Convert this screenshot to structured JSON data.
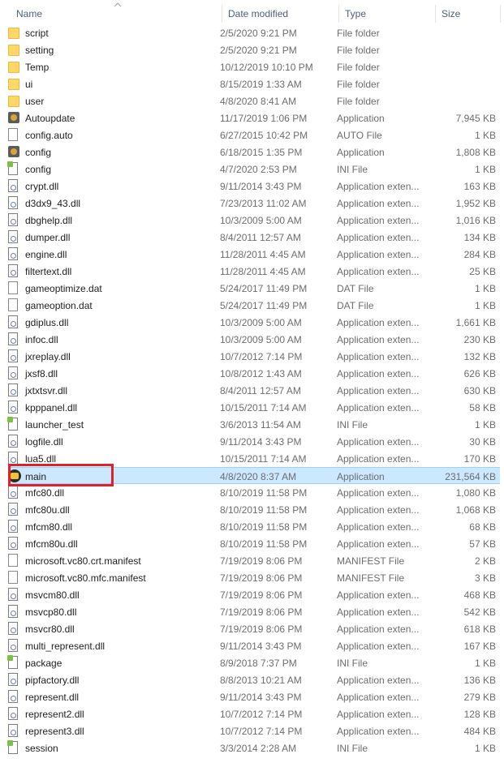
{
  "columns": {
    "name": "Name",
    "date": "Date modified",
    "type": "Type",
    "size": "Size"
  },
  "rows": [
    {
      "name": "script",
      "date": "2/5/2020 9:21 PM",
      "type": "File folder",
      "size": "",
      "icon": "folder-icon"
    },
    {
      "name": "setting",
      "date": "2/5/2020 9:21 PM",
      "type": "File folder",
      "size": "",
      "icon": "folder-icon"
    },
    {
      "name": "Temp",
      "date": "10/12/2019 10:10 PM",
      "type": "File folder",
      "size": "",
      "icon": "folder-icon"
    },
    {
      "name": "ui",
      "date": "8/15/2019 1:33 AM",
      "type": "File folder",
      "size": "",
      "icon": "folder-icon"
    },
    {
      "name": "user",
      "date": "4/8/2020 8:41 AM",
      "type": "File folder",
      "size": "",
      "icon": "folder-icon"
    },
    {
      "name": "Autoupdate",
      "date": "11/17/2019 1:06 PM",
      "type": "Application",
      "size": "7,945 KB",
      "icon": "app-icon"
    },
    {
      "name": "config.auto",
      "date": "6/27/2015 10:42 PM",
      "type": "AUTO File",
      "size": "1 KB",
      "icon": "file-icon"
    },
    {
      "name": "config",
      "date": "6/18/2015 1:35 PM",
      "type": "Application",
      "size": "1,808 KB",
      "icon": "app-icon"
    },
    {
      "name": "config",
      "date": "4/7/2020 2:53 PM",
      "type": "INI File",
      "size": "1 KB",
      "icon": "ini-icon"
    },
    {
      "name": "crypt.dll",
      "date": "9/11/2014 3:43 PM",
      "type": "Application exten...",
      "size": "163 KB",
      "icon": "dll-icon"
    },
    {
      "name": "d3dx9_43.dll",
      "date": "7/23/2013 11:02 AM",
      "type": "Application exten...",
      "size": "1,952 KB",
      "icon": "dll-icon"
    },
    {
      "name": "dbghelp.dll",
      "date": "10/3/2009 5:00 AM",
      "type": "Application exten...",
      "size": "1,016 KB",
      "icon": "dll-icon"
    },
    {
      "name": "dumper.dll",
      "date": "8/4/2011 12:57 AM",
      "type": "Application exten...",
      "size": "134 KB",
      "icon": "dll-icon"
    },
    {
      "name": "engine.dll",
      "date": "11/28/2011 4:45 AM",
      "type": "Application exten...",
      "size": "284 KB",
      "icon": "dll-icon"
    },
    {
      "name": "filtertext.dll",
      "date": "11/28/2011 4:45 AM",
      "type": "Application exten...",
      "size": "25 KB",
      "icon": "dll-icon"
    },
    {
      "name": "gameoptimize.dat",
      "date": "5/24/2017 11:49 PM",
      "type": "DAT File",
      "size": "1 KB",
      "icon": "file-icon"
    },
    {
      "name": "gameoption.dat",
      "date": "5/24/2017 11:49 PM",
      "type": "DAT File",
      "size": "1 KB",
      "icon": "file-icon"
    },
    {
      "name": "gdiplus.dll",
      "date": "10/3/2009 5:00 AM",
      "type": "Application exten...",
      "size": "1,661 KB",
      "icon": "dll-icon"
    },
    {
      "name": "infoc.dll",
      "date": "10/3/2009 5:00 AM",
      "type": "Application exten...",
      "size": "230 KB",
      "icon": "dll-icon"
    },
    {
      "name": "jxreplay.dll",
      "date": "10/7/2012 7:14 PM",
      "type": "Application exten...",
      "size": "132 KB",
      "icon": "dll-icon"
    },
    {
      "name": "jxsf8.dll",
      "date": "10/8/2012 1:43 AM",
      "type": "Application exten...",
      "size": "626 KB",
      "icon": "dll-icon"
    },
    {
      "name": "jxtxtsvr.dll",
      "date": "8/4/2011 12:57 AM",
      "type": "Application exten...",
      "size": "630 KB",
      "icon": "dll-icon"
    },
    {
      "name": "kpppanel.dll",
      "date": "10/15/2011 7:14 AM",
      "type": "Application exten...",
      "size": "58 KB",
      "icon": "dll-icon"
    },
    {
      "name": "launcher_test",
      "date": "3/6/2013 11:54 AM",
      "type": "INI File",
      "size": "1 KB",
      "icon": "ini-icon"
    },
    {
      "name": "logfile.dll",
      "date": "9/11/2014 3:43 PM",
      "type": "Application exten...",
      "size": "30 KB",
      "icon": "dll-icon"
    },
    {
      "name": "lua5.dll",
      "date": "10/15/2011 7:14 AM",
      "type": "Application exten...",
      "size": "170 KB",
      "icon": "dll-icon"
    },
    {
      "name": "main",
      "date": "4/8/2020 8:37 AM",
      "type": "Application",
      "size": "231,564 KB",
      "icon": "main-app-icon",
      "selected": true
    },
    {
      "name": "mfc80.dll",
      "date": "8/10/2019 11:58 PM",
      "type": "Application exten...",
      "size": "1,080 KB",
      "icon": "dll-icon"
    },
    {
      "name": "mfc80u.dll",
      "date": "8/10/2019 11:58 PM",
      "type": "Application exten...",
      "size": "1,068 KB",
      "icon": "dll-icon"
    },
    {
      "name": "mfcm80.dll",
      "date": "8/10/2019 11:58 PM",
      "type": "Application exten...",
      "size": "68 KB",
      "icon": "dll-icon"
    },
    {
      "name": "mfcm80u.dll",
      "date": "8/10/2019 11:58 PM",
      "type": "Application exten...",
      "size": "57 KB",
      "icon": "dll-icon"
    },
    {
      "name": "microsoft.vc80.crt.manifest",
      "date": "7/19/2019 8:06 PM",
      "type": "MANIFEST File",
      "size": "2 KB",
      "icon": "file-icon"
    },
    {
      "name": "microsoft.vc80.mfc.manifest",
      "date": "7/19/2019 8:06 PM",
      "type": "MANIFEST File",
      "size": "3 KB",
      "icon": "file-icon"
    },
    {
      "name": "msvcm80.dll",
      "date": "7/19/2019 8:06 PM",
      "type": "Application exten...",
      "size": "468 KB",
      "icon": "dll-icon"
    },
    {
      "name": "msvcp80.dll",
      "date": "7/19/2019 8:06 PM",
      "type": "Application exten...",
      "size": "542 KB",
      "icon": "dll-icon"
    },
    {
      "name": "msvcr80.dll",
      "date": "7/19/2019 8:06 PM",
      "type": "Application exten...",
      "size": "618 KB",
      "icon": "dll-icon"
    },
    {
      "name": "multi_represent.dll",
      "date": "9/11/2014 3:43 PM",
      "type": "Application exten...",
      "size": "167 KB",
      "icon": "dll-icon"
    },
    {
      "name": "package",
      "date": "8/9/2018 7:37 PM",
      "type": "INI File",
      "size": "1 KB",
      "icon": "ini-icon"
    },
    {
      "name": "pipfactory.dll",
      "date": "8/8/2013 10:21 AM",
      "type": "Application exten...",
      "size": "136 KB",
      "icon": "dll-icon"
    },
    {
      "name": "represent.dll",
      "date": "9/11/2014 3:43 PM",
      "type": "Application exten...",
      "size": "279 KB",
      "icon": "dll-icon"
    },
    {
      "name": "represent2.dll",
      "date": "10/7/2012 7:14 PM",
      "type": "Application exten...",
      "size": "128 KB",
      "icon": "dll-icon"
    },
    {
      "name": "represent3.dll",
      "date": "10/7/2012 7:14 PM",
      "type": "Application exten...",
      "size": "484 KB",
      "icon": "dll-icon"
    },
    {
      "name": "session",
      "date": "3/3/2014 2:28 AM",
      "type": "INI File",
      "size": "1 KB",
      "icon": "ini-icon"
    }
  ]
}
